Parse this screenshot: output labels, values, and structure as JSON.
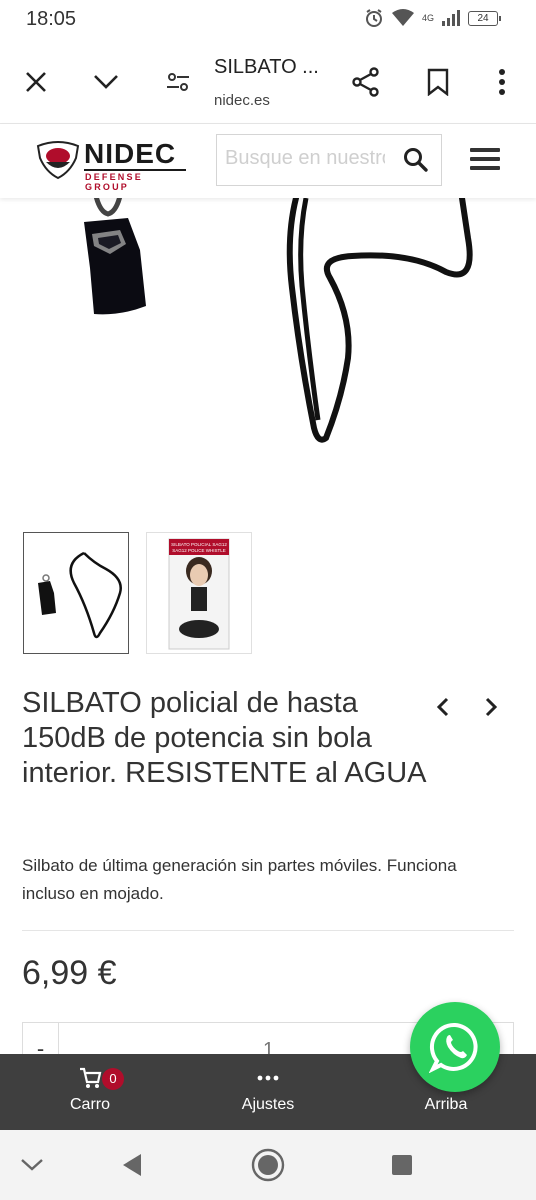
{
  "status_bar": {
    "time": "18:05",
    "network": "4G",
    "battery": "24"
  },
  "tab": {
    "title": "SILBATO ...",
    "domain": "nidec.es"
  },
  "logo": {
    "brand": "NIDEC",
    "tagline": "DEFENSE GROUP"
  },
  "search": {
    "placeholder": "Busque en nuestro catálogo"
  },
  "product": {
    "title": "SILBATO policial de hasta 150dB de potencia sin bola interior. RESISTENTE al AGUA",
    "description": "Silbato de última generación sin partes móviles. Funciona incluso en mojado.",
    "price": "6,99 €",
    "quantity": "1",
    "quantity_minus": "-"
  },
  "thumbnail_2_label": [
    "SILBATO POLICIAL SAG12",
    "SAG12 POLICE WHISTLE"
  ],
  "toolbar": {
    "cart_label": "Carro",
    "cart_count": "0",
    "settings_label": "Ajustes",
    "top_label": "Arriba"
  },
  "colors": {
    "brand_red": "#b00d2b",
    "toolbar_bg": "#3f3f3f",
    "whatsapp": "#2bd15f"
  }
}
